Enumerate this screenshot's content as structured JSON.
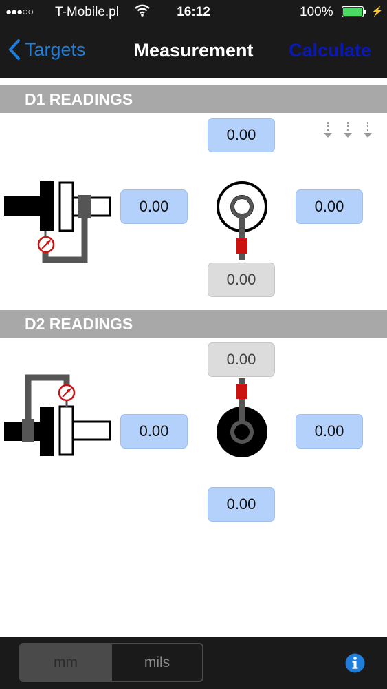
{
  "status_bar": {
    "signal": "●●●○○",
    "carrier": "T-Mobile.pl",
    "time": "16:12",
    "battery_percent": "100%"
  },
  "nav": {
    "back_label": "Targets",
    "title": "Measurement",
    "action_label": "Calculate"
  },
  "d1": {
    "header": "D1 READINGS",
    "top": "0.00",
    "left": "0.00",
    "right": "0.00",
    "bottom": "0.00"
  },
  "d2": {
    "header": "D2 READINGS",
    "top": "0.00",
    "left": "0.00",
    "right": "0.00",
    "bottom": "0.00"
  },
  "units": {
    "options": [
      "mm",
      "mils"
    ],
    "selected": "mm"
  },
  "colors": {
    "accent_blue": "#1f7ddb",
    "calculate_blue": "#0a18b8",
    "field_blue": "#b3d1fa",
    "field_gray": "#dcdcdc",
    "header_gray": "#a8a8a8",
    "indicator_red": "#cc1111",
    "battery_green": "#4cd964"
  },
  "icons": {
    "back": "chevron-left-icon",
    "wifi": "wifi-icon",
    "battery": "battery-icon",
    "charging": "bolt-icon",
    "info": "info-icon",
    "sort": "down-arrows-icon",
    "dial": "dial-indicator-icon"
  }
}
